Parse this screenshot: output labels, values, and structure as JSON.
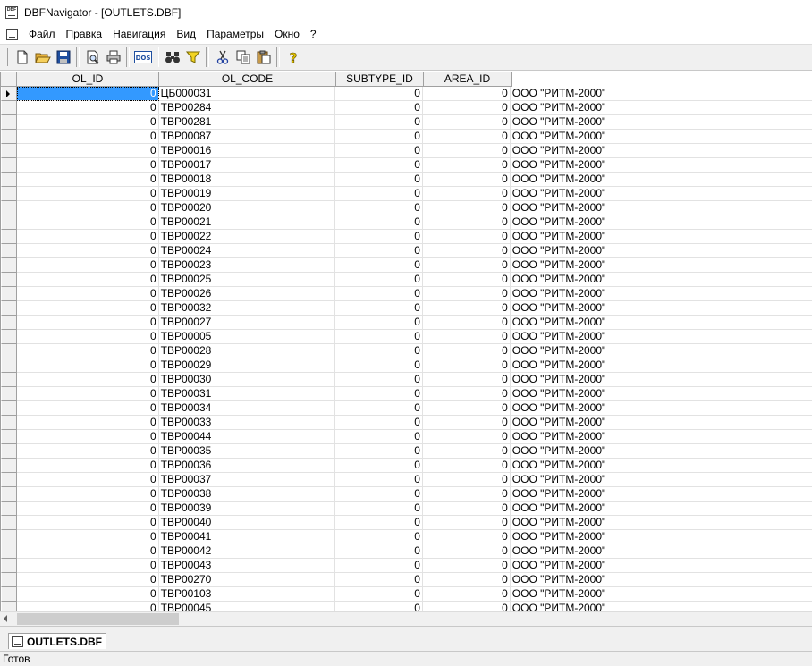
{
  "window": {
    "title": "DBFNavigator - [OUTLETS.DBF]"
  },
  "menu": {
    "items": [
      "Файл",
      "Правка",
      "Навигация",
      "Вид",
      "Параметры",
      "Окно",
      "?"
    ]
  },
  "toolbar": {
    "buttons": [
      {
        "name": "new-file-icon"
      },
      {
        "name": "open-folder-icon"
      },
      {
        "name": "save-disk-icon"
      },
      {
        "name": "print-preview-icon"
      },
      {
        "name": "print-icon"
      },
      {
        "name": "dos-encoding-icon",
        "label": "DOS"
      },
      {
        "name": "find-binoculars-icon"
      },
      {
        "name": "filter-funnel-icon"
      },
      {
        "name": "cut-scissors-icon"
      },
      {
        "name": "copy-icon"
      },
      {
        "name": "paste-icon"
      },
      {
        "name": "help-icon"
      }
    ],
    "dos_label": "DOS",
    "help_label": "?"
  },
  "table": {
    "columns": [
      "OL_ID",
      "OL_CODE",
      "SUBTYPE_ID",
      "AREA_ID",
      ""
    ],
    "rows": [
      [
        "0",
        "ЦБ000031",
        "0",
        "0",
        "ООО \"РИТМ-2000\""
      ],
      [
        "0",
        "ТВР00284",
        "0",
        "0",
        "ООО \"РИТМ-2000\""
      ],
      [
        "0",
        "ТВР00281",
        "0",
        "0",
        "ООО \"РИТМ-2000\""
      ],
      [
        "0",
        "ТВР00087",
        "0",
        "0",
        "ООО \"РИТМ-2000\""
      ],
      [
        "0",
        "ТВР00016",
        "0",
        "0",
        "ООО \"РИТМ-2000\""
      ],
      [
        "0",
        "ТВР00017",
        "0",
        "0",
        "ООО \"РИТМ-2000\""
      ],
      [
        "0",
        "ТВР00018",
        "0",
        "0",
        "ООО \"РИТМ-2000\""
      ],
      [
        "0",
        "ТВР00019",
        "0",
        "0",
        "ООО \"РИТМ-2000\""
      ],
      [
        "0",
        "ТВР00020",
        "0",
        "0",
        "ООО \"РИТМ-2000\""
      ],
      [
        "0",
        "ТВР00021",
        "0",
        "0",
        "ООО \"РИТМ-2000\""
      ],
      [
        "0",
        "ТВР00022",
        "0",
        "0",
        "ООО \"РИТМ-2000\""
      ],
      [
        "0",
        "ТВР00024",
        "0",
        "0",
        "ООО \"РИТМ-2000\""
      ],
      [
        "0",
        "ТВР00023",
        "0",
        "0",
        "ООО \"РИТМ-2000\""
      ],
      [
        "0",
        "ТВР00025",
        "0",
        "0",
        "ООО \"РИТМ-2000\""
      ],
      [
        "0",
        "ТВР00026",
        "0",
        "0",
        "ООО \"РИТМ-2000\""
      ],
      [
        "0",
        "ТВР00032",
        "0",
        "0",
        "ООО \"РИТМ-2000\""
      ],
      [
        "0",
        "ТВР00027",
        "0",
        "0",
        "ООО \"РИТМ-2000\""
      ],
      [
        "0",
        "ТВР00005",
        "0",
        "0",
        "ООО \"РИТМ-2000\""
      ],
      [
        "0",
        "ТВР00028",
        "0",
        "0",
        "ООО \"РИТМ-2000\""
      ],
      [
        "0",
        "ТВР00029",
        "0",
        "0",
        "ООО \"РИТМ-2000\""
      ],
      [
        "0",
        "ТВР00030",
        "0",
        "0",
        "ООО \"РИТМ-2000\""
      ],
      [
        "0",
        "ТВР00031",
        "0",
        "0",
        "ООО \"РИТМ-2000\""
      ],
      [
        "0",
        "ТВР00034",
        "0",
        "0",
        "ООО \"РИТМ-2000\""
      ],
      [
        "0",
        "ТВР00033",
        "0",
        "0",
        "ООО \"РИТМ-2000\""
      ],
      [
        "0",
        "ТВР00044",
        "0",
        "0",
        "ООО \"РИТМ-2000\""
      ],
      [
        "0",
        "ТВР00035",
        "0",
        "0",
        "ООО \"РИТМ-2000\""
      ],
      [
        "0",
        "ТВР00036",
        "0",
        "0",
        "ООО \"РИТМ-2000\""
      ],
      [
        "0",
        "ТВР00037",
        "0",
        "0",
        "ООО \"РИТМ-2000\""
      ],
      [
        "0",
        "ТВР00038",
        "0",
        "0",
        "ООО \"РИТМ-2000\""
      ],
      [
        "0",
        "ТВР00039",
        "0",
        "0",
        "ООО \"РИТМ-2000\""
      ],
      [
        "0",
        "ТВР00040",
        "0",
        "0",
        "ООО \"РИТМ-2000\""
      ],
      [
        "0",
        "ТВР00041",
        "0",
        "0",
        "ООО \"РИТМ-2000\""
      ],
      [
        "0",
        "ТВР00042",
        "0",
        "0",
        "ООО \"РИТМ-2000\""
      ],
      [
        "0",
        "ТВР00043",
        "0",
        "0",
        "ООО \"РИТМ-2000\""
      ],
      [
        "0",
        "ТВР00270",
        "0",
        "0",
        "ООО \"РИТМ-2000\""
      ],
      [
        "0",
        "ТВР00103",
        "0",
        "0",
        "ООО \"РИТМ-2000\""
      ],
      [
        "0",
        "ТВР00045",
        "0",
        "0",
        "ООО \"РИТМ-2000\""
      ]
    ]
  },
  "tabs": {
    "active": "OUTLETS.DBF"
  },
  "status": {
    "text": "Готов"
  },
  "colors": {
    "selection": "#3399ff",
    "chrome": "#f0f0f0"
  }
}
